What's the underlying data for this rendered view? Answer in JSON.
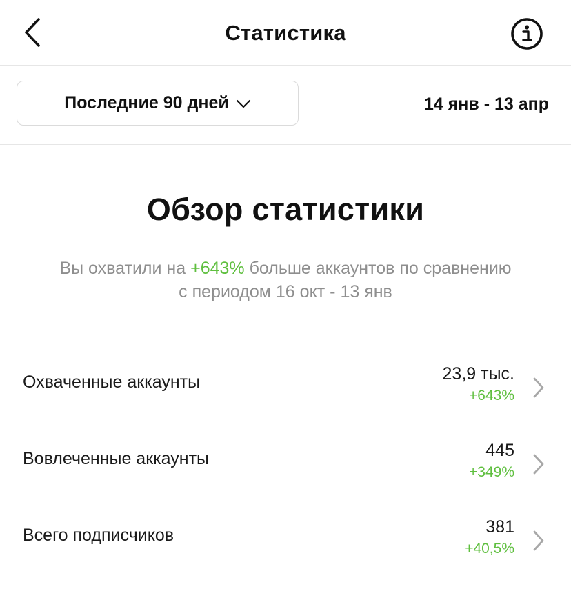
{
  "header": {
    "title": "Статистика",
    "back_icon": "chevron-left-icon",
    "info_icon": "info-circle-icon"
  },
  "filter": {
    "period_label": "Последние 90 дней",
    "period_icon": "chevron-down-icon",
    "date_range": "14 янв - 13 апр"
  },
  "overview": {
    "title": "Обзор статистики",
    "summary_prefix": "Вы охватили на ",
    "summary_highlight": "+643%",
    "summary_suffix": " больше аккаунтов по сравнению с периодом 16 окт - 13 янв"
  },
  "metrics": [
    {
      "label": "Охваченные аккаунты",
      "value": "23,9 тыс.",
      "delta": "+643%"
    },
    {
      "label": "Вовлеченные аккаунты",
      "value": "445",
      "delta": "+349%"
    },
    {
      "label": "Всего подписчиков",
      "value": "381",
      "delta": "+40,5%"
    }
  ],
  "colors": {
    "accent_green": "#5fbf3f",
    "muted_text": "#8e8e8e",
    "divider": "#e6e6e6"
  }
}
